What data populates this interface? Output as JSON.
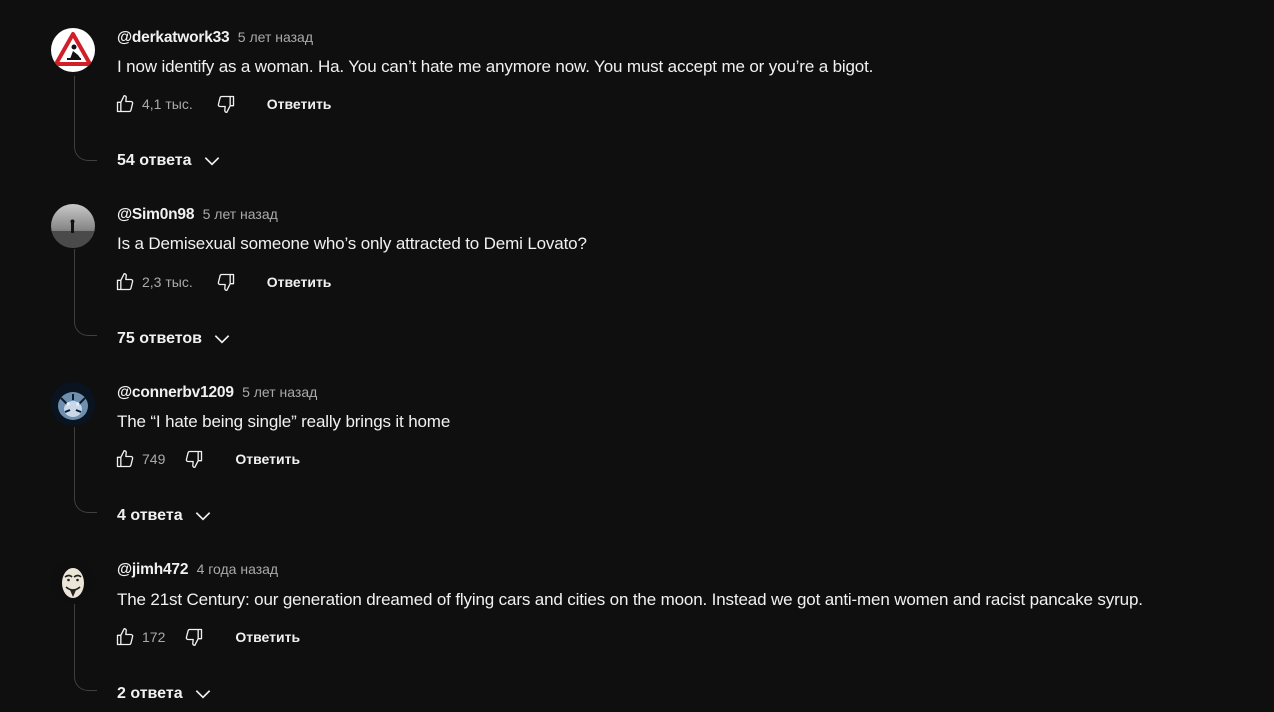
{
  "comments": [
    {
      "author": "@derkatwork33",
      "time": "5 лет назад",
      "text": "I now identify as a woman.  Ha. You can’t hate me anymore now.  You must accept me or you’re a bigot.",
      "likes": "4,1 тыс.",
      "reply_label": "Ответить",
      "replies_label": "54 ответа",
      "avatar_icon": "warning-sign-icon"
    },
    {
      "author": "@Sim0n98",
      "time": "5 лет назад",
      "text": "Is a Demisexual someone who’s only attracted to Demi Lovato?",
      "likes": "2,3 тыс.",
      "reply_label": "Ответить",
      "replies_label": "75 ответов",
      "avatar_icon": "person-landscape-icon"
    },
    {
      "author": "@connerbv1209",
      "time": "5 лет назад",
      "text": "The “I hate being single” really brings it home",
      "likes": "749",
      "reply_label": "Ответить",
      "replies_label": "4 ответа",
      "avatar_icon": "tiger-icon"
    },
    {
      "author": "@jimh472",
      "time": "4 года назад",
      "text": "The 21st Century:  our generation dreamed of flying cars and cities on the moon.  Instead we got anti-men women and racist pancake syrup.",
      "likes": "172",
      "reply_label": "Ответить",
      "replies_label": "2 ответа",
      "avatar_icon": "guy-fawkes-mask-icon"
    }
  ],
  "colors": {
    "background": "#0f0f0f",
    "text": "#f1f1f1",
    "secondary_text": "#aaaaaa",
    "thread_line": "#3f3f3f"
  }
}
